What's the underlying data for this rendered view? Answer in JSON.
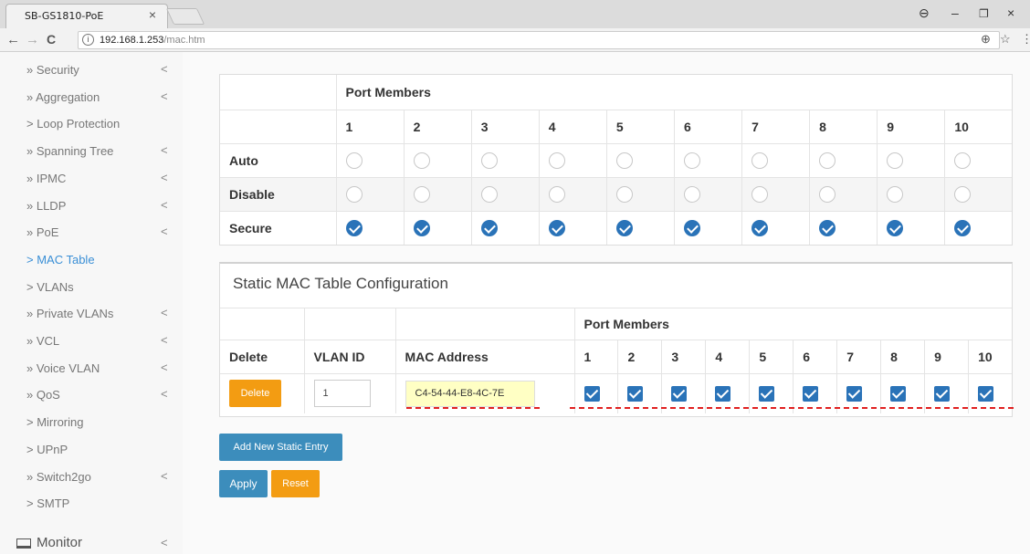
{
  "browser": {
    "tab_title": "SB-GS1810-PoE",
    "tab_close": "×",
    "url_host": "192.168.1.253",
    "url_path": "/mac.htm",
    "back": "←",
    "forward": "→",
    "reload": "C",
    "info": "i",
    "zoom": "⊕",
    "star": "☆",
    "menu": "⋮",
    "account": "⊖",
    "minimize": "–",
    "restore": "❐",
    "close": "×"
  },
  "sidebar": {
    "chevron": "<",
    "items": [
      {
        "label": "» Security",
        "chevron": true
      },
      {
        "label": "» Aggregation",
        "chevron": true
      },
      {
        "label": "> Loop Protection",
        "chevron": false
      },
      {
        "label": "» Spanning Tree",
        "chevron": true
      },
      {
        "label": "» IPMC",
        "chevron": true
      },
      {
        "label": "» LLDP",
        "chevron": true
      },
      {
        "label": "» PoE",
        "chevron": true
      },
      {
        "label": "> MAC Table",
        "chevron": false,
        "active": true
      },
      {
        "label": "> VLANs",
        "chevron": false
      },
      {
        "label": "» Private VLANs",
        "chevron": true
      },
      {
        "label": "» VCL",
        "chevron": true
      },
      {
        "label": "» Voice VLAN",
        "chevron": true
      },
      {
        "label": "» QoS",
        "chevron": true
      },
      {
        "label": "> Mirroring",
        "chevron": false
      },
      {
        "label": "> UPnP",
        "chevron": false
      },
      {
        "label": "» Switch2go",
        "chevron": true
      },
      {
        "label": "> SMTP",
        "chevron": false
      }
    ],
    "monitor": {
      "label": "Monitor",
      "chevron": "<"
    }
  },
  "learning_table": {
    "header": "Port Members",
    "ports": [
      "1",
      "2",
      "3",
      "4",
      "5",
      "6",
      "7",
      "8",
      "9",
      "10"
    ],
    "rows": [
      {
        "label": "Auto",
        "state": "unselected"
      },
      {
        "label": "Disable",
        "state": "unselected"
      },
      {
        "label": "Secure",
        "state": "selected"
      }
    ]
  },
  "static_table": {
    "title": "Static MAC Table Configuration",
    "port_members_header": "Port Members",
    "col_delete": "Delete",
    "col_vlan": "VLAN ID",
    "col_mac": "MAC Address",
    "ports": [
      "1",
      "2",
      "3",
      "4",
      "5",
      "6",
      "7",
      "8",
      "9",
      "10"
    ],
    "entry": {
      "delete_label": "Delete",
      "vlan_id": "1",
      "mac": "C4-54-44-E8-4C-7E",
      "port_checked": [
        true,
        true,
        true,
        true,
        true,
        true,
        true,
        true,
        true,
        true
      ]
    }
  },
  "buttons": {
    "add_entry": "Add New Static Entry",
    "apply": "Apply",
    "reset": "Reset"
  },
  "colors": {
    "accent": "#3a8fd6",
    "check_blue": "#2a73b8",
    "orange": "#f39c12",
    "button_blue": "#3c8dbc",
    "mac_highlight": "#ffffc4",
    "annotation_red": "#e02020"
  }
}
